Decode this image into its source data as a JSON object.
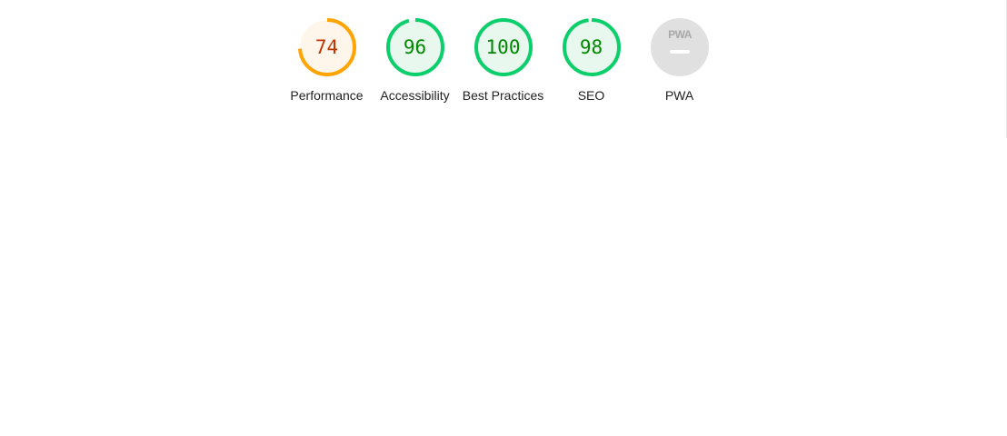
{
  "gauges": [
    {
      "label": "Performance",
      "value": "74",
      "score": 0.74,
      "status": "average",
      "ring_color": "#ffa400",
      "fill_color": "#fff6eb",
      "text_color": "#c33300"
    },
    {
      "label": "Accessibility",
      "value": "96",
      "score": 0.96,
      "status": "pass",
      "ring_color": "#0cce6b",
      "fill_color": "#e8f8ee",
      "text_color": "#008800"
    },
    {
      "label": "Best Practices",
      "value": "100",
      "score": 1.0,
      "status": "pass",
      "ring_color": "#0cce6b",
      "fill_color": "#e8f8ee",
      "text_color": "#008800"
    },
    {
      "label": "SEO",
      "value": "98",
      "score": 0.98,
      "status": "pass",
      "ring_color": "#0cce6b",
      "fill_color": "#e8f8ee",
      "text_color": "#008800"
    }
  ],
  "pwa": {
    "label": "PWA",
    "badge_text": "PWA",
    "icon": "pwa-badge-icon",
    "status": "not-applicable",
    "fill_color": "#e0e0e0",
    "text_color": "#a8a8a8"
  }
}
